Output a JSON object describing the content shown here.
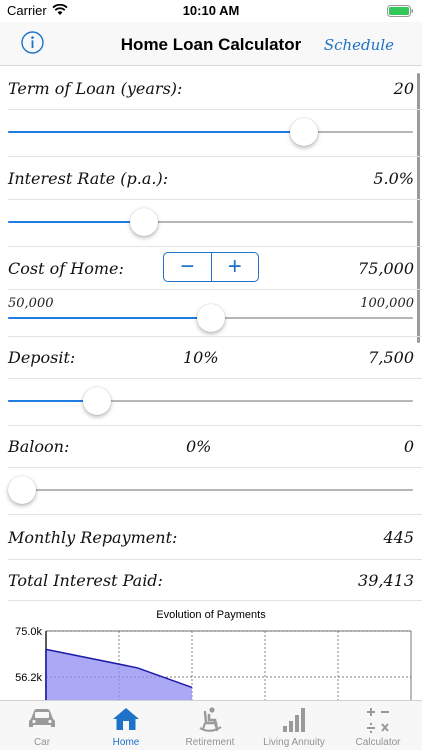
{
  "status": {
    "carrier": "Carrier",
    "time": "10:10 AM"
  },
  "nav": {
    "title": "Home Loan Calculator",
    "schedule_label": "Schedule"
  },
  "term": {
    "label": "Term of Loan (years):",
    "value": "20",
    "slider_fraction": 0.73
  },
  "rate": {
    "label": "Interest Rate (p.a.):",
    "value": "5.0%",
    "slider_fraction": 0.335
  },
  "cost": {
    "label": "Cost of Home:",
    "value": "75,000",
    "min": "50,000",
    "max": "100,000",
    "slider_fraction": 0.5,
    "minus": "−",
    "plus": "+"
  },
  "deposit": {
    "label": "Deposit:",
    "percent": "10%",
    "value": "7,500",
    "slider_fraction": 0.22
  },
  "baloon": {
    "label": "Baloon:",
    "percent": "0%",
    "value": "0",
    "slider_fraction": 0.035
  },
  "results": {
    "monthly_label": "Monthly Repayment:",
    "monthly_value": "445",
    "interest_label": "Total Interest Paid:",
    "interest_value": "39,413"
  },
  "chart_data": {
    "type": "area",
    "title": "Evolution of Payments",
    "y_ticks": [
      "75.0k",
      "56.2k"
    ],
    "ylim": [
      0,
      75000
    ],
    "series": [
      {
        "x": [
          0,
          0.25,
          0.4
        ],
        "values": [
          67500,
          60000,
          52000
        ]
      }
    ]
  },
  "tabs": [
    {
      "label": "Car",
      "icon": "car-icon",
      "active": false
    },
    {
      "label": "Home",
      "icon": "house-icon",
      "active": true
    },
    {
      "label": "Retirement",
      "icon": "rocking-chair-icon",
      "active": false
    },
    {
      "label": "Living Annuity",
      "icon": "bar-chart-icon",
      "active": false
    },
    {
      "label": "Calculator",
      "icon": "calculator-icon",
      "active": false
    }
  ],
  "colors": {
    "accent": "#1e72c8",
    "slider_fill": "#1f7ce0",
    "chart_fill": "#8f8cf2"
  }
}
